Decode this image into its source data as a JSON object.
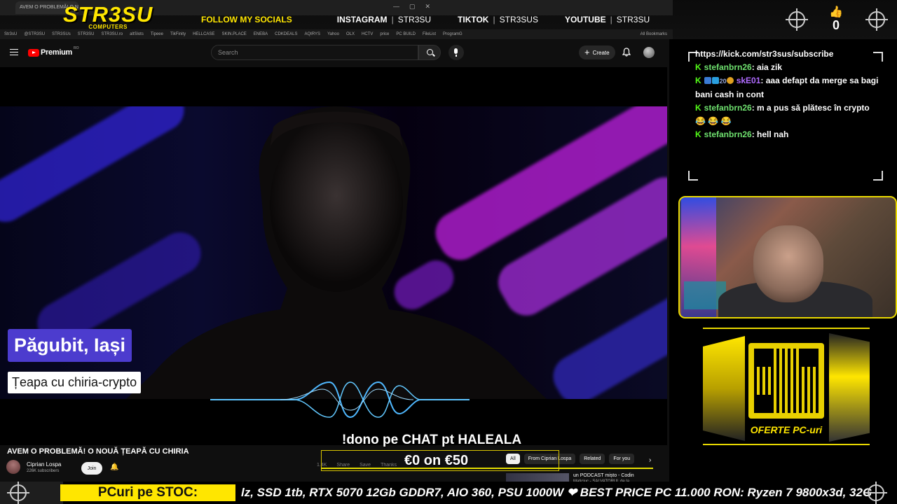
{
  "overlay": {
    "brand_name": "STR3SU",
    "brand_sub": "COMPUTERS",
    "follow": "FOLLOW MY SOCIALS",
    "socials": [
      {
        "platform": "INSTAGRAM",
        "handle": "STR3SU"
      },
      {
        "platform": "TIKTOK",
        "handle": "STR3SUS"
      },
      {
        "platform": "YOUTUBE",
        "handle": "STR3SU"
      }
    ],
    "like_count": "0",
    "accent_color": "#ffe600"
  },
  "browser": {
    "tab_title": "AVEM O PROBLEMĂ! O NOU...",
    "bookmarks": [
      "Str3sU",
      "@STR3SU",
      "STR3SUs",
      "STR3SU",
      "STR3SU.ro",
      "altSlots",
      "Tipeee",
      "TikFinity",
      "HELLCASE",
      "SKIN.PLACE",
      "ENEBA",
      "CDKDEALS",
      "AQIRYS",
      "Yahoo",
      "OLX",
      "HCTV",
      "price",
      "PC BUILD",
      "FileList",
      "ProgramG"
    ],
    "all_bookmarks": "All Bookmarks"
  },
  "youtube": {
    "logo_text": "Premium",
    "country": "RO",
    "search_placeholder": "Search",
    "create_label": "Create",
    "video": {
      "title_card": "Păgubit, Iași",
      "subtitle_card": "Țeapa cu chiria-crypto"
    },
    "video_title": "AVEM O PROBLEMĂ! O NOUĂ ȚEAPĂ CU CHIRIA",
    "channel": {
      "name": "Ciprian Lospa",
      "subscribers": "226K subscribers"
    },
    "join_label": "Join",
    "actions": [
      "1.4K",
      "Share",
      "Save",
      "Thanks"
    ],
    "chips": [
      {
        "label": "All",
        "active": true
      },
      {
        "label": "From Ciprian Lospa",
        "active": false
      },
      {
        "label": "Related",
        "active": false
      },
      {
        "label": "For you",
        "active": false
      }
    ],
    "related": {
      "title": "un PODCAST mișto - Codin",
      "channel": "Maticiuc - SALVATORUL de la ..."
    }
  },
  "donation": {
    "command": "!dono pe CHAT pt HALEALA",
    "progress": "€0 on €50",
    "raised": 0,
    "goal": 50
  },
  "chat": {
    "messages": [
      {
        "user": "",
        "text": "https://kick.com/str3sus/subscribe",
        "color": "#ffffff"
      },
      {
        "user": "stefanbrn26",
        "text": ": aia zik",
        "color": "#6ee06e"
      },
      {
        "user": "skE01",
        "text": ": aaa defapt da merge sa bagi bani cash in cont",
        "color": "#b06bff"
      },
      {
        "user": "stefanbrn26",
        "text": ": m a pus să plătesc în crypto 😂 😂 😂",
        "color": "#6ee06e"
      },
      {
        "user": "stefanbrn26",
        "text": ": hell nah",
        "color": "#6ee06e"
      }
    ],
    "badge_count": "20"
  },
  "promo": {
    "label": "OFERTE PC-uri"
  },
  "ticker": {
    "label": "PCuri pe STOC:",
    "text": "lz, SSD 1tb, RTX 5070 12Gb GDDR7, AIO 360, PSU 1000W  ❤ BEST PRICE PC 11.000 RON: Ryzen 7 9800x3d, 32G"
  }
}
